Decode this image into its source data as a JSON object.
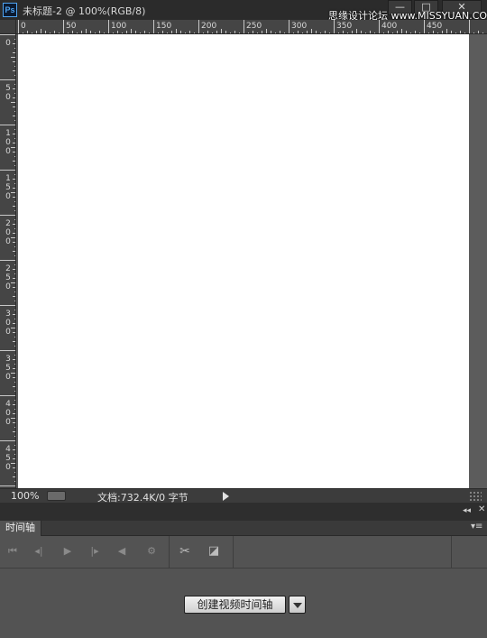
{
  "window": {
    "app_icon_text": "Ps",
    "title": "未标题-2 @ 100%(RGB/8)",
    "minimize_label": "—",
    "maximize_label": "□",
    "close_label": "✕",
    "watermark": "思缘设计论坛 www.MISSYUAN.COM"
  },
  "ruler": {
    "horizontal_labels": [
      "0",
      "50",
      "100",
      "150",
      "200",
      "250",
      "300",
      "350",
      "400",
      "450"
    ],
    "vertical_labels": [
      "0",
      "50",
      "100",
      "150",
      "200",
      "250",
      "300",
      "350",
      "400",
      "450"
    ]
  },
  "status_bar": {
    "zoom": "100%",
    "doc_info": "文档:732.4K/0 字节"
  },
  "dock": {
    "collapse_icon": "◂◂",
    "close_icon": "✕"
  },
  "timeline_panel": {
    "tab_label": "时间轴",
    "menu_icon": "▾≡",
    "controls": [
      {
        "name": "first-frame-icon",
        "glyph": "⏮"
      },
      {
        "name": "previous-frame-icon",
        "glyph": "◂|"
      },
      {
        "name": "play-icon",
        "glyph": "▶"
      },
      {
        "name": "next-frame-icon",
        "glyph": "|▸"
      },
      {
        "name": "audio-icon",
        "glyph": "◀"
      },
      {
        "name": "settings-gear-icon",
        "glyph": "⚙"
      },
      {
        "name": "scissors-icon",
        "glyph": "✂"
      },
      {
        "name": "transition-icon",
        "glyph": "◪"
      }
    ],
    "create_button_label": "创建视频时间轴"
  },
  "colors": {
    "canvas": "#ffffff",
    "workspace_bg": "#535353",
    "titlebar_bg": "#2b2b2b",
    "ps_icon_accent": "#4fa4f2"
  }
}
